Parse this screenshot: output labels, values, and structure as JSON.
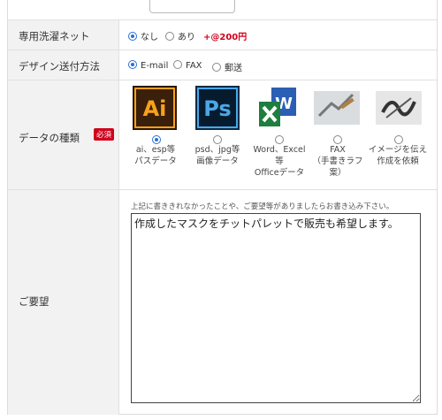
{
  "rows": {
    "laundry_net": {
      "label": "専用洗濯ネット",
      "options": [
        {
          "label": "なし",
          "selected": true
        },
        {
          "label": "あり",
          "selected": false
        }
      ],
      "price": "+@200円"
    },
    "design_send": {
      "label": "デザイン送付方法",
      "options": [
        {
          "label": "E-mail",
          "selected": true
        },
        {
          "label": "FAX",
          "selected": false
        },
        {
          "label": "郵送",
          "selected": false
        }
      ]
    },
    "data_type": {
      "label": "データの種類",
      "required_badge": "必須",
      "icons": {
        "ai": "Ai",
        "ps": "Ps",
        "word": "W"
      },
      "options": [
        {
          "line1": "ai、esp等",
          "line2": "パスデータ",
          "line3": "",
          "selected": true
        },
        {
          "line1": "psd、jpg等",
          "line2": "画像データ",
          "line3": "",
          "selected": false
        },
        {
          "line1": "Word、Excel",
          "line2": "等",
          "line3": "Officeデータ",
          "selected": false
        },
        {
          "line1": "FAX",
          "line2": "（手書きラフ",
          "line3": "案）",
          "selected": false
        },
        {
          "line1": "イメージを伝え",
          "line2": "作成を依頼",
          "line3": "",
          "selected": false
        }
      ]
    },
    "request": {
      "label": "ご要望",
      "hint": "上記に書ききれなかったことや、ご要望等がありましたらお書き込み下さい。",
      "value": "作成したマスクをチットパレットで販売も希望します。"
    }
  }
}
